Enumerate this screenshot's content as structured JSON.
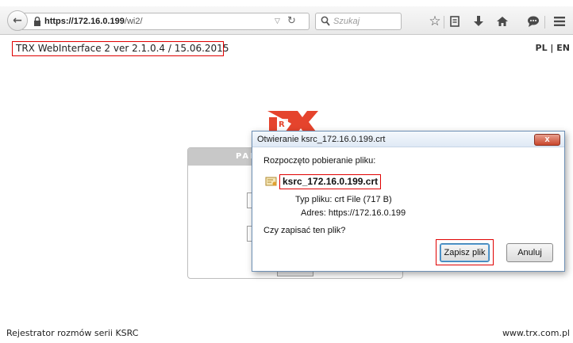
{
  "browser": {
    "url_host": "https://172.16.0.199",
    "url_path": "/wi2/",
    "search_placeholder": "Szukaj",
    "back_icon": "back-arrow-icon",
    "lock_icon": "padlock-icon",
    "toolbar_icons": [
      "star-bookmark-icon",
      "reading-list-icon",
      "download-icon",
      "home-icon",
      "chat-bubble-icon",
      "hamburger-menu-icon"
    ]
  },
  "page": {
    "header_title": "TRX WebInterface 2 ver 2.1.0.4 / 15.06.2015",
    "lang_switch": "PL | EN",
    "panel_header": "PAN",
    "footer_left": "Rejestrator rozmów serii KSRC",
    "footer_right": "www.trx.com.pl"
  },
  "dialog": {
    "title": "Otwieranie ksrc_172.16.0.199.crt",
    "close_label": "x",
    "intro": "Rozpoczęto pobieranie pliku:",
    "file_name": "ksrc_172.16.0.199.crt",
    "type_label": "Typ pliku:",
    "type_value": "crt File (717 B)",
    "address_label": "Adres:",
    "address_value": "https://172.16.0.199",
    "question": "Czy zapisać ten plik?",
    "save_button": "Zapisz plik",
    "cancel_button": "Anuluj"
  },
  "colors": {
    "highlight_red": "#e00000",
    "logo_red": "#e5442d",
    "dialog_border": "#6d8fb4"
  }
}
